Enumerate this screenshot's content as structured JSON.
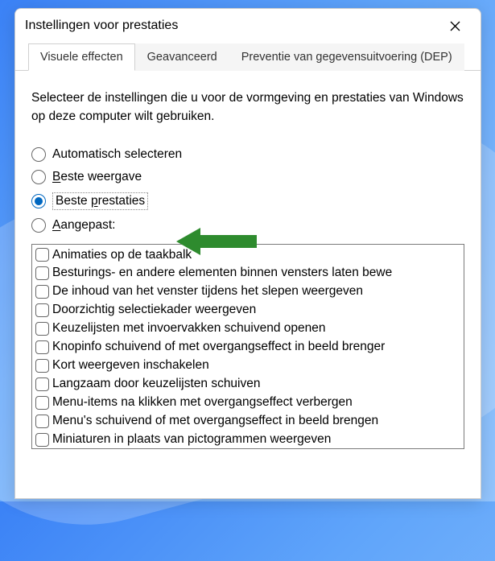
{
  "window": {
    "title": "Instellingen voor prestaties"
  },
  "tabs": [
    {
      "label": "Visuele effecten",
      "active": true
    },
    {
      "label": "Geavanceerd",
      "active": false
    },
    {
      "label": "Preventie van gegevensuitvoering (DEP)",
      "active": false
    }
  ],
  "instruction": "Selecteer de instellingen die u voor de vormgeving en prestaties van Windows op deze computer wilt gebruiken.",
  "radios": [
    {
      "label": "Automatisch selecteren",
      "selected": false,
      "accel": ""
    },
    {
      "label": "Beste weergave",
      "selected": false,
      "accel": "B"
    },
    {
      "label": "Beste prestaties",
      "selected": true,
      "accel": "p"
    },
    {
      "label": "Aangepast:",
      "selected": false,
      "accel": "A"
    }
  ],
  "checkboxes": [
    "Animaties op de taakbalk",
    "Besturings- en andere elementen binnen vensters laten bewe",
    "De inhoud van het venster tijdens het slepen weergeven",
    "Doorzichtig selectiekader weergeven",
    "Keuzelijsten met invoervakken schuivend openen",
    "Knopinfo schuivend of met overgangseffect in beeld brenger",
    "Kort weergeven inschakelen",
    "Langzaam door keuzelijsten schuiven",
    "Menu-items na klikken met overgangseffect verbergen",
    "Menu's schuivend of met overgangseffect in beeld brengen",
    "Miniaturen in plaats van pictogrammen weergeven"
  ]
}
